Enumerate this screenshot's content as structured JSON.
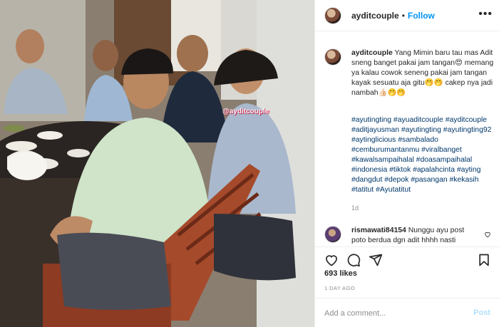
{
  "post": {
    "image_alt": "Five young men sitting at a restaurant table",
    "watermark": "@ayditcouple"
  },
  "header": {
    "username": "ayditcouple",
    "separator": "•",
    "follow_label": "Follow",
    "more_label": "•••"
  },
  "caption": {
    "username": "ayditcouple",
    "text": "Yang Mimin baru tau mas Adit sneng banget pakai jam tangan😍 memang ya kalau cowok seneng pakai jam tangan kayak sesuatu aja gitu🤭🤭 cakep nya jadi nambah👍🏻🤭🤭",
    "hashtags": "#ayutingting #ayuaditcouple #ayditcouple #aditjayusman #ayutingting #ayutingting92 #aytinglicious #sambalado #cemburumantanmu #viralbanget #kawalsampaihalal #doasampaihalal #indonesia #tiktok #apalahcinta #ayting #dangdut #depok #pasangan #kekasih #tatitut #Ayutatitut",
    "time": "1d"
  },
  "reply": {
    "username": "rismawati84154",
    "text": "Nunggu ayu post poto berdua dgn adit hhhh nasti"
  },
  "actions": {
    "like_icon": "heart-icon",
    "comment_icon": "comment-icon",
    "share_icon": "share-icon",
    "save_icon": "bookmark-icon"
  },
  "likes": "693 likes",
  "posted_time": "1 DAY AGO",
  "add_comment": {
    "placeholder": "Add a comment...",
    "post_label": "Post"
  },
  "colors": {
    "link": "#0095f6",
    "hashtag": "#00376b",
    "muted": "#8e8e8e",
    "post_disabled": "#b2dffc",
    "divider": "#efefef"
  }
}
